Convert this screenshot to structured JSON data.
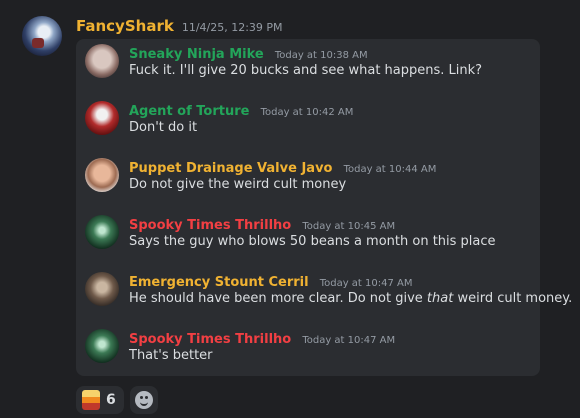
{
  "author": {
    "name": "FancyShark",
    "timestamp": "11/4/25, 12:39 PM"
  },
  "messages": [
    {
      "user": "Sneaky Ninja Mike",
      "time": "Today at 10:38 AM",
      "text": "Fuck it. I'll give 20 bucks and see what happens. Link?",
      "color": "#23a55a"
    },
    {
      "user": "Agent of Torture",
      "time": "Today at 10:42 AM",
      "text": "Don't do it",
      "color": "#23a55a"
    },
    {
      "user": "Puppet Drainage Valve Javo",
      "time": "Today at 10:44 AM",
      "text": "Do not give the weird cult money",
      "color": "#f0b232"
    },
    {
      "user": "Spooky Times Thrillho",
      "time": "Today at 10:45 AM",
      "text": "Says the guy who blows 50 beans a month on this place",
      "color": "#f23f43"
    },
    {
      "user": "Emergency Stount Cerril",
      "time": "Today at 10:47 AM",
      "text_before": "He should have been more clear. Do not give ",
      "text_em": "that",
      "text_after": " weird cult money.",
      "color": "#f0b232"
    },
    {
      "user": "Spooky Times Thrillho",
      "time": "Today at 10:47 AM",
      "text": "That's better",
      "color": "#f23f43"
    }
  ],
  "reactions": [
    {
      "emoji": "drink-emoji",
      "count": "6"
    }
  ],
  "add_reaction_icon": "smiley-icon"
}
